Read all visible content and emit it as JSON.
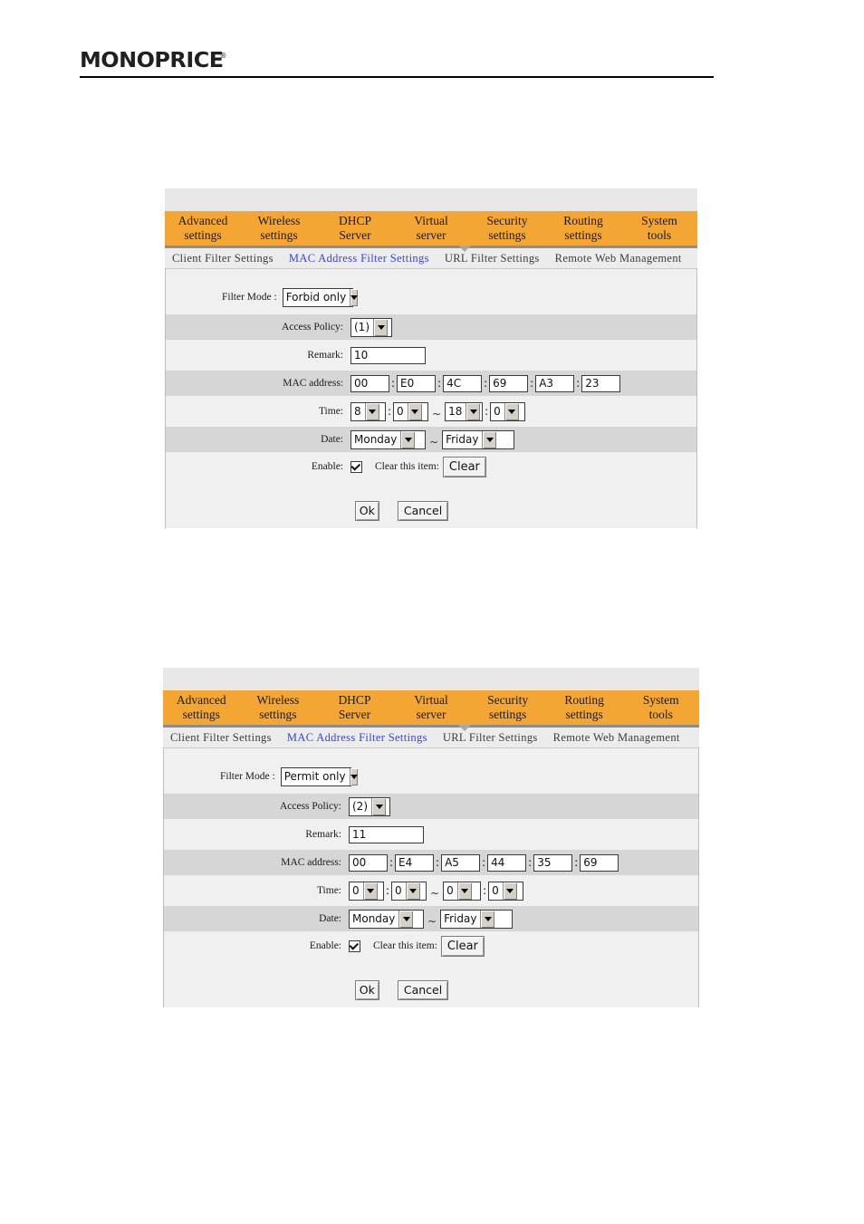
{
  "brand": {
    "logo_text": "MONOPRICE",
    "registered_mark": "®"
  },
  "nav": {
    "main_items": [
      {
        "line1": "Advanced",
        "line2": "settings"
      },
      {
        "line1": "Wireless",
        "line2": "settings"
      },
      {
        "line1": "DHCP",
        "line2": "Server"
      },
      {
        "line1": "Virtual",
        "line2": "server"
      },
      {
        "line1": "Security",
        "line2": "settings"
      },
      {
        "line1": "Routing",
        "line2": "settings"
      },
      {
        "line1": "System",
        "line2": "tools"
      }
    ],
    "active_main": "Security settings",
    "sub_items": [
      {
        "label": "Client Filter Settings",
        "active": false
      },
      {
        "label": "MAC Address Filter Settings",
        "active": true
      },
      {
        "label": "URL Filter Settings",
        "active": false
      },
      {
        "label": "Remote Web Management",
        "active": false
      }
    ]
  },
  "labels": {
    "filter_mode": "Filter Mode :",
    "access_policy": "Access Policy:",
    "remark": "Remark:",
    "mac_address": "MAC address:",
    "time": "Time:",
    "date": "Date:",
    "enable": "Enable:",
    "clear_this_item": "Clear this item:",
    "clear_button": "Clear",
    "ok_button": "Ok",
    "cancel_button": "Cancel",
    "colon": ":",
    "tilde": "~"
  },
  "panel1": {
    "filter_mode": "Forbid only",
    "access_policy": "(1)",
    "remark": "10",
    "mac": [
      "00",
      "E0",
      "4C",
      "69",
      "A3",
      "23"
    ],
    "time_start_hour": "8",
    "time_start_min": "0",
    "time_end_hour": "18",
    "time_end_min": "0",
    "date_start": "Monday",
    "date_end": "Friday",
    "enable_checked": true
  },
  "panel2": {
    "filter_mode": "Permit only",
    "access_policy": "(2)",
    "remark": "11",
    "mac": [
      "00",
      "E4",
      "A5",
      "44",
      "35",
      "69"
    ],
    "time_start_hour": "0",
    "time_start_min": "0",
    "time_end_hour": "0",
    "time_end_min": "0",
    "date_start": "Monday",
    "date_end": "Friday",
    "enable_checked": true
  },
  "colors": {
    "nav_orange": "#f4a634",
    "nav_underline": "#8c8c8c",
    "active_link": "#3a45d8",
    "row_shaded": "#d6d6d6",
    "panel_bg": "#f0f0f0"
  }
}
